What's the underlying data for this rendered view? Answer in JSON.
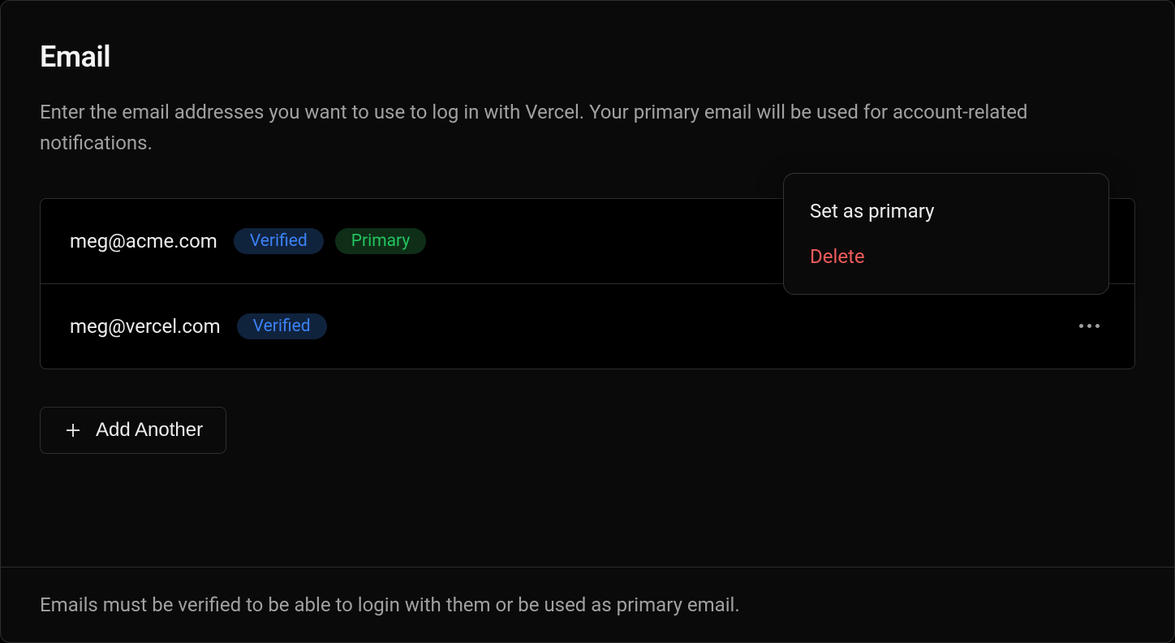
{
  "card": {
    "title": "Email",
    "description": "Enter the email addresses you want to use to log in with Vercel. Your primary email will be used for account-related notifications."
  },
  "emails": [
    {
      "address": "meg@acme.com",
      "verified_label": "Verified",
      "primary_label": "Primary",
      "is_primary": true
    },
    {
      "address": "meg@vercel.com",
      "verified_label": "Verified",
      "primary_label": "",
      "is_primary": false
    }
  ],
  "add_button_label": "Add Another",
  "footer_text": "Emails must be verified to be able to login with them or be used as primary email.",
  "menu": {
    "set_primary": "Set as primary",
    "delete": "Delete"
  }
}
